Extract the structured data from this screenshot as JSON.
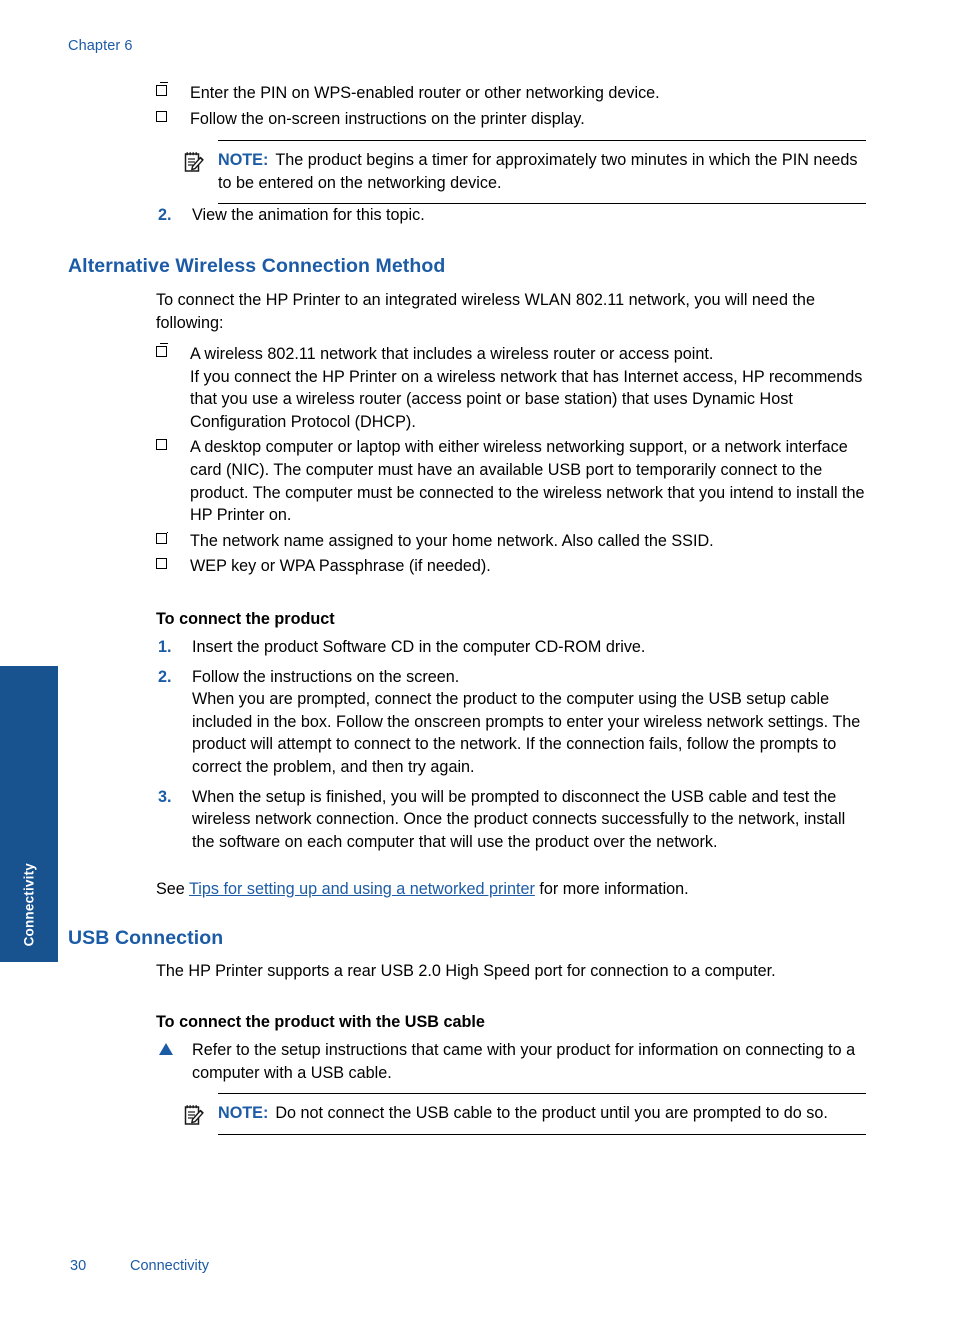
{
  "page": {
    "chapter_header": "Chapter 6",
    "page_number": "30",
    "footer_section": "Connectivity",
    "side_tab_label": "Connectivity",
    "accent_blue": "#1c5ba5",
    "tab_blue": "#18528f"
  },
  "top_steps": {
    "bullets": [
      "Enter the PIN on WPS-enabled router or other networking device.",
      "Follow the on-screen instructions on the printer display."
    ],
    "note": {
      "icon": "note-pad-pencil-icon",
      "label": "NOTE:",
      "text": "The product begins a timer for approximately two minutes in which the PIN needs to be entered on the networking device."
    },
    "step2": "View the animation for this topic."
  },
  "alt_wireless": {
    "heading": "Alternative Wireless Connection Method",
    "intro": "To connect the HP Printer to an integrated wireless WLAN 802.11 network, you will need the following:",
    "requirements": [
      {
        "main": "A wireless 802.11 network that includes a wireless router or access point.",
        "detail": "If you connect the HP Printer on a wireless network that has Internet access, HP recommends that you use a wireless router (access point or base station) that uses Dynamic Host Configuration Protocol (DHCP)."
      },
      {
        "main": "A desktop computer or laptop with either wireless networking support, or a network interface card (NIC). The computer must have an available USB port to temporarily connect to the product. The computer must be connected to the wireless network that you intend to install the HP Printer on.",
        "detail": ""
      },
      {
        "main": "The network name assigned to your home network. Also called the SSID.",
        "detail": ""
      },
      {
        "main": "WEP key or WPA Passphrase (if needed).",
        "detail": ""
      }
    ],
    "procedure_title": "To connect the product",
    "steps": [
      {
        "main": "Insert the product Software CD in the computer CD-ROM drive.",
        "detail": ""
      },
      {
        "main": "Follow the instructions on the screen.",
        "detail": "When you are prompted, connect the product to the computer using the USB setup cable included in the box. Follow the onscreen prompts to enter your wireless network settings. The product will attempt to connect to the network. If the connection fails, follow the prompts to correct the problem, and then try again."
      },
      {
        "main": "When the setup is finished, you will be prompted to disconnect the USB cable and test the wireless network connection. Once the product connects successfully to the network, install the software on each computer that will use the product over the network.",
        "detail": ""
      }
    ],
    "see_also": {
      "prefix": "See ",
      "link_text": "Tips for setting up and using a networked printer",
      "suffix": " for more information."
    }
  },
  "usb": {
    "heading": "USB Connection",
    "intro": "The HP Printer supports a rear USB 2.0 High Speed port for connection to a computer.",
    "procedure_title": "To connect the product with the USB cable",
    "single_step": "Refer to the setup instructions that came with your product for information on connecting to a computer with a USB cable.",
    "note": {
      "icon": "note-pad-pencil-icon",
      "label": "NOTE:",
      "text": "Do not connect the USB cable to the product until you are prompted to do so."
    }
  }
}
